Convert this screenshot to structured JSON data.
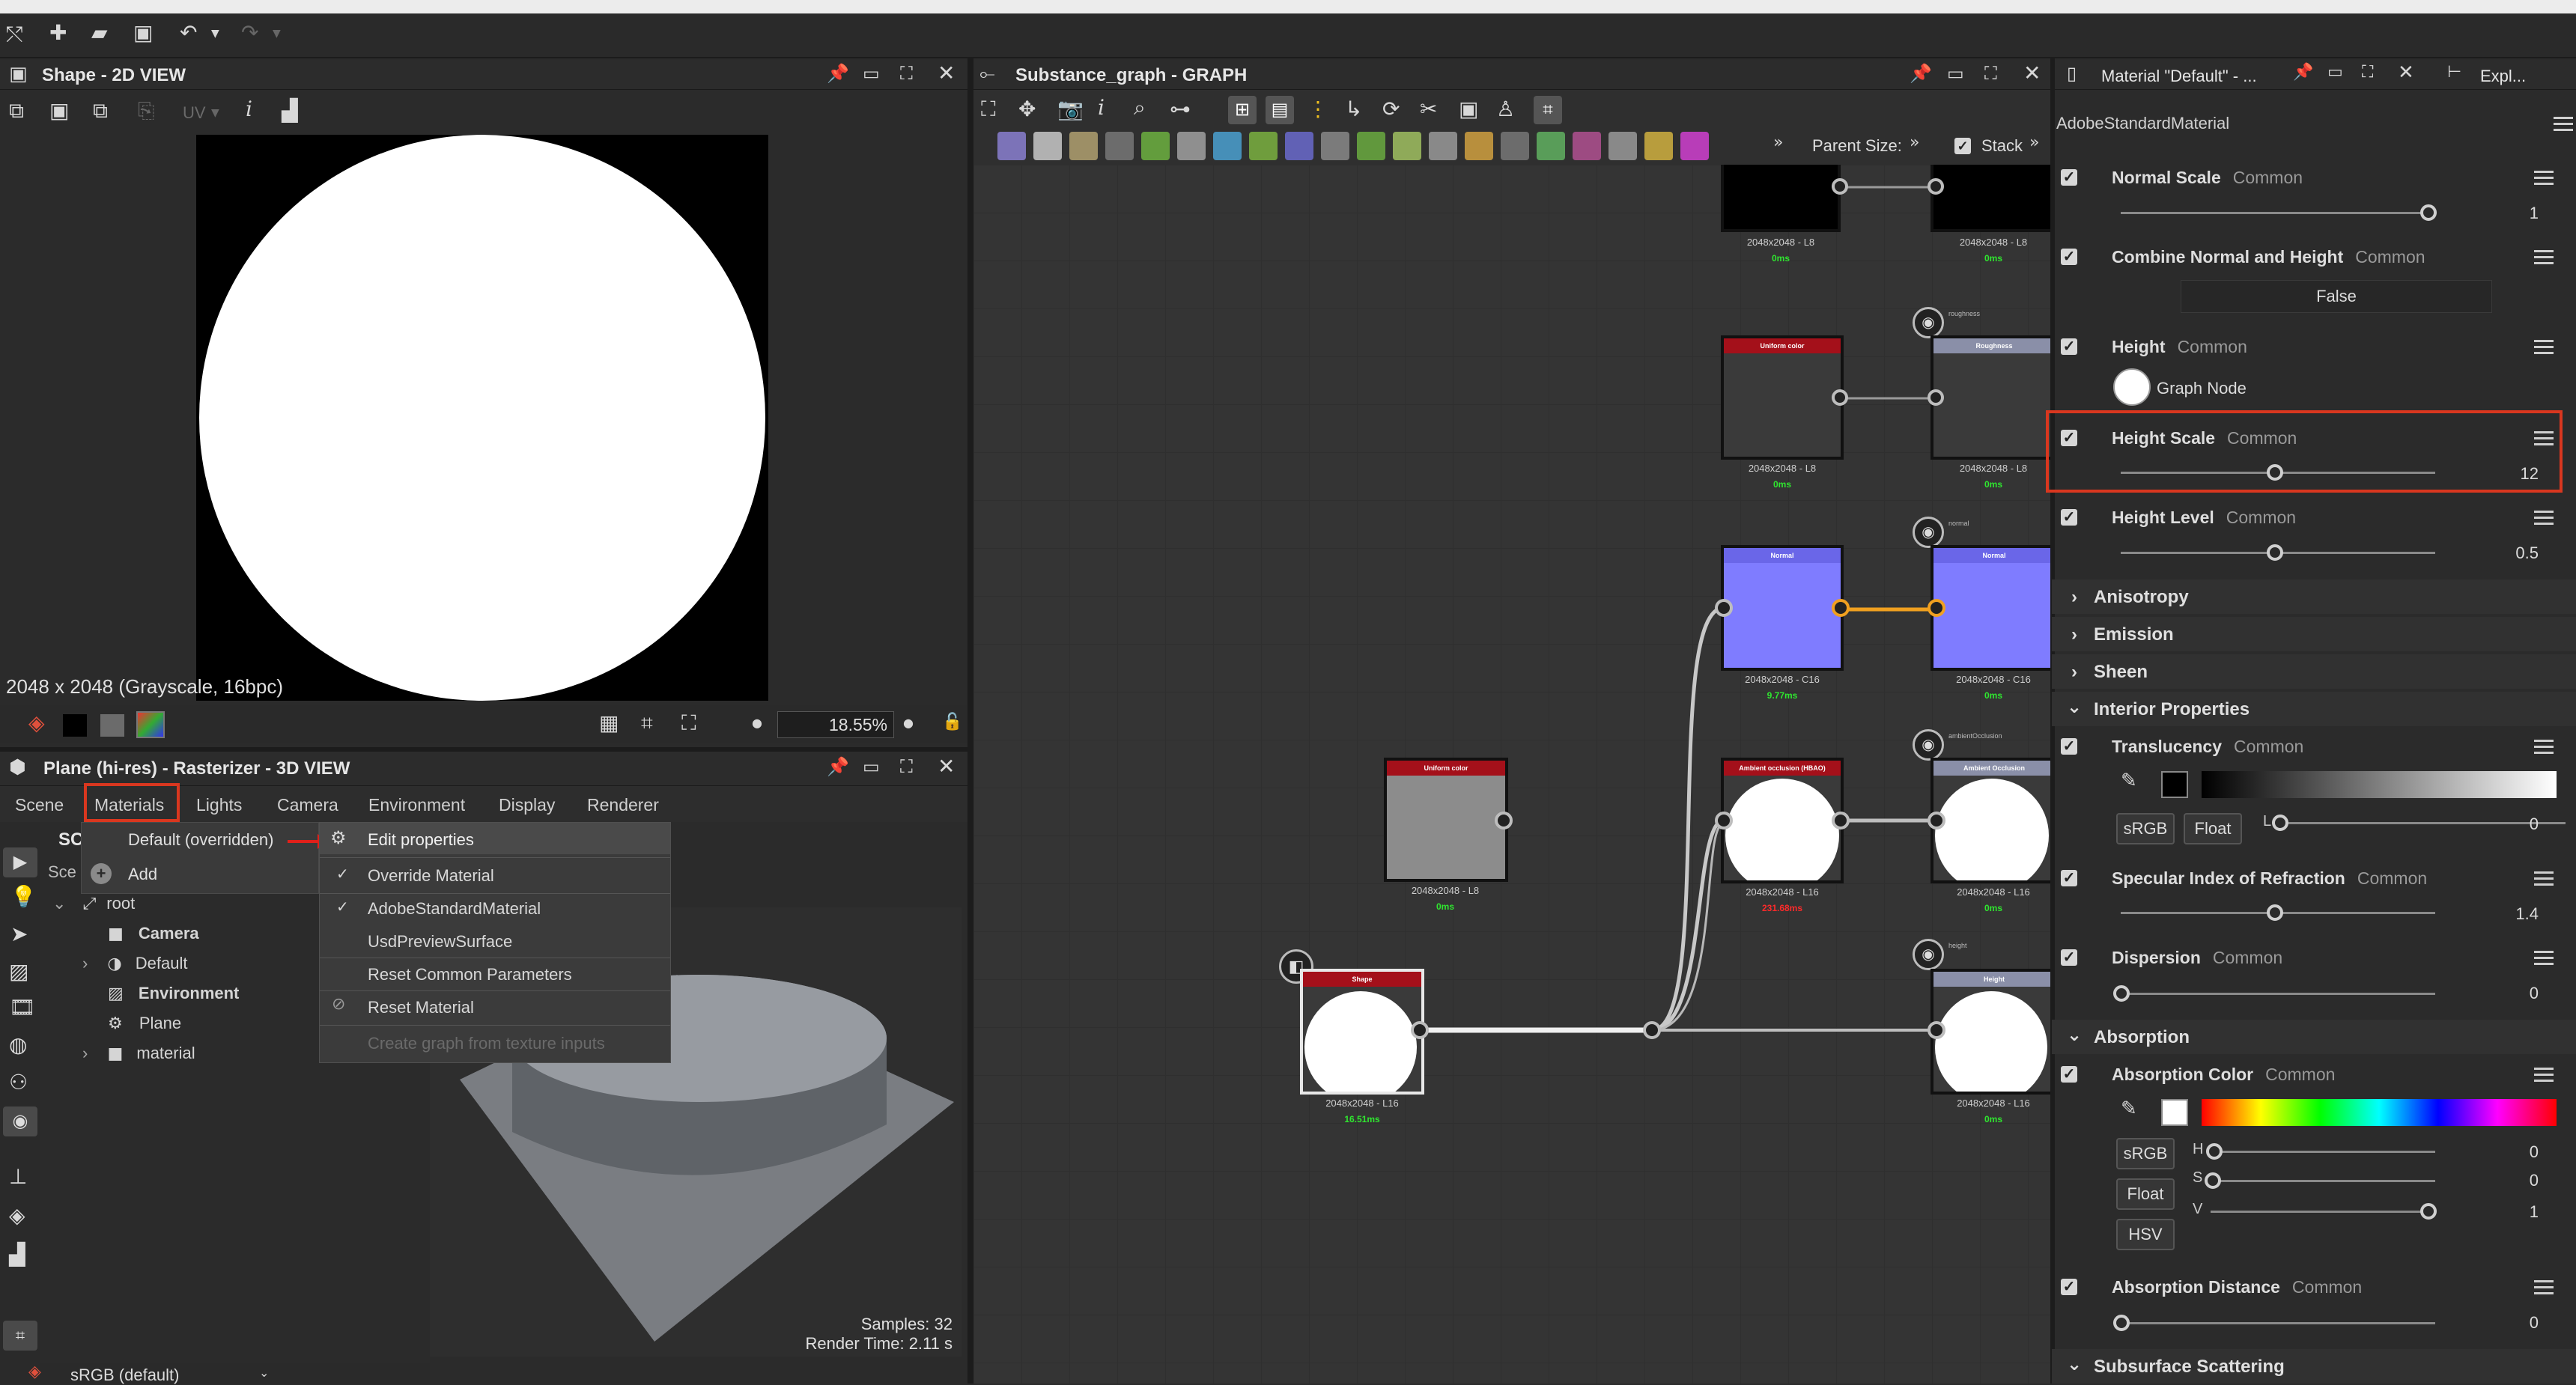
{
  "toolbar": {
    "icons": [
      "share-icon",
      "add-asset-icon",
      "open-folder-icon",
      "save-icon",
      "undo-icon",
      "redo-icon"
    ]
  },
  "view2d": {
    "title": "Shape - 2D VIEW",
    "uv_label": "UV",
    "info": "2048 x 2048 (Grayscale, 16bpc)",
    "zoom": "18.55%"
  },
  "view3d": {
    "title": "Plane (hi-res) - Rasterizer - 3D VIEW",
    "menu": [
      "Scene",
      "Materials",
      "Lights",
      "Camera",
      "Environment",
      "Display",
      "Renderer"
    ],
    "scene_tab": "Sce",
    "scene_tab2": "SC",
    "tree": {
      "root": "root",
      "items": [
        "Camera",
        "Default",
        "Environment",
        "Plane",
        "material"
      ]
    },
    "samples": "Samples: 32",
    "render_time": "Render Time: 2.11 s",
    "colorspace": "sRGB (default)"
  },
  "materials_menu": {
    "item": "Default (overridden)",
    "add": "Add"
  },
  "context_menu": {
    "edit": "Edit properties",
    "override": "Override Material",
    "adobe": "AdobeStandardMaterial",
    "usd": "UsdPreviewSurface",
    "reset_common": "Reset Common Parameters",
    "reset": "Reset Material",
    "create_graph": "Create graph from texture inputs"
  },
  "graph": {
    "title": "Substance_graph - GRAPH",
    "parent_size": "Parent Size:",
    "stack": "Stack",
    "nodes": {
      "n1": {
        "label": "2048x2048 - L8",
        "time": "0ms"
      },
      "n2": {
        "label": "2048x2048 - L8",
        "time": "0ms"
      },
      "uniform1": {
        "header": "Uniform color",
        "label": "2048x2048 - L8",
        "time": "0ms"
      },
      "rough": {
        "header": "Roughness",
        "tag": "roughness",
        "label": "2048x2048 - L8",
        "time": "0ms"
      },
      "normal1": {
        "header": "Normal",
        "label": "2048x2048 - C16",
        "time": "9.77ms"
      },
      "normal2": {
        "header": "Normal",
        "tag": "normal",
        "label": "2048x2048 - C16",
        "time": "0ms"
      },
      "uniform2": {
        "header": "Uniform color",
        "label": "2048x2048 - L8",
        "time": "0ms"
      },
      "ao1": {
        "header": "Ambient occlusion (HBAO)",
        "label": "2048x2048 - L16",
        "time": "231.68ms"
      },
      "ao2": {
        "header": "Ambient Occlusion",
        "tag": "ambientOcclusion",
        "label": "2048x2048 - L16",
        "time": "0ms"
      },
      "shape": {
        "header": "Shape",
        "label": "2048x2048 - L16",
        "time": "16.51ms"
      },
      "height": {
        "header": "Height",
        "tag": "height",
        "label": "2048x2048 - L16",
        "time": "0ms"
      }
    }
  },
  "props": {
    "title": "Material \"Default\" - ...",
    "explorer_tab": "Expl...",
    "material_type": "AdobeStandardMaterial",
    "normal_scale": {
      "name": "Normal Scale",
      "cat": "Common",
      "value": "1",
      "fraction": 1.0
    },
    "combine": {
      "name": "Combine Normal and Height",
      "cat": "Common",
      "value": "False"
    },
    "height": {
      "name": "Height",
      "cat": "Common",
      "value": "Graph Node"
    },
    "height_scale": {
      "name": "Height Scale",
      "cat": "Common",
      "value": "12",
      "fraction": 0.5
    },
    "height_level": {
      "name": "Height Level",
      "cat": "Common",
      "value": "0.5",
      "fraction": 0.5
    },
    "sections": {
      "anisotropy": "Anisotropy",
      "emission": "Emission",
      "sheen": "Sheen",
      "interior": "Interior Properties",
      "absorption": "Absorption",
      "subsurface": "Subsurface Scattering"
    },
    "translucency": {
      "name": "Translucency",
      "cat": "Common",
      "l_label": "L",
      "value": "0",
      "srgb": "sRGB",
      "float": "Float"
    },
    "ior": {
      "name": "Specular Index of Refraction",
      "cat": "Common",
      "value": "1.4",
      "fraction": 0.5
    },
    "dispersion": {
      "name": "Dispersion",
      "cat": "Common",
      "value": "0",
      "fraction": 0.0
    },
    "absorption_color": {
      "name": "Absorption Color",
      "cat": "Common",
      "srgb": "sRGB",
      "float": "Float",
      "hsv": "HSV",
      "h_label": "H",
      "s_label": "S",
      "v_label": "V",
      "h": "0",
      "s": "0",
      "v": "1"
    },
    "absorption_distance": {
      "name": "Absorption Distance",
      "cat": "Common",
      "value": "0"
    }
  },
  "colors": {
    "highlight": "#d9371f",
    "wire_orange": "#f0a020",
    "normal_blue": "#7f7cff",
    "node_red": "#a4101a"
  }
}
